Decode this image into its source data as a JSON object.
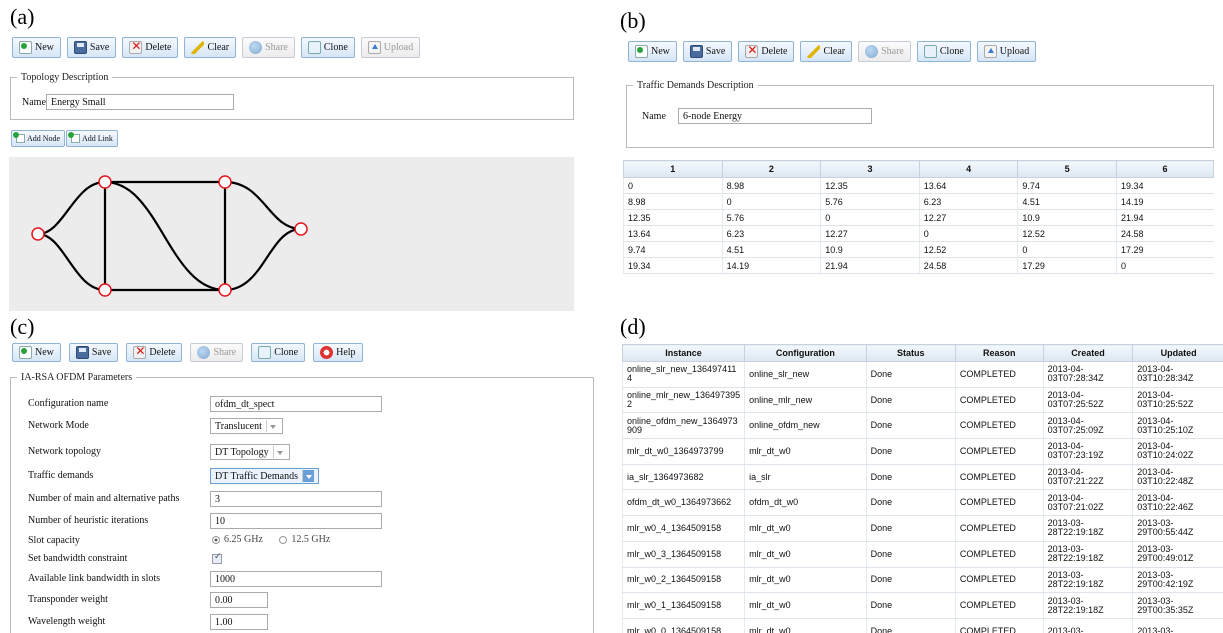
{
  "panels": {
    "a": "(a)",
    "b": "(b)",
    "c": "(c)",
    "d": "(d)"
  },
  "panel_a": {
    "toolbar": {
      "new": "New",
      "save": "Save",
      "delete": "Delete",
      "clear": "Clear",
      "share": "Share",
      "clone": "Clone",
      "upload": "Upload"
    },
    "legend": "Topology Description",
    "name_label": "Name",
    "name_value": "Energy Small",
    "add_node": "Add Node",
    "add_link": "Add Link"
  },
  "panel_b": {
    "toolbar": {
      "new": "New",
      "save": "Save",
      "delete": "Delete",
      "clear": "Clear",
      "share": "Share",
      "clone": "Clone",
      "upload": "Upload"
    },
    "legend": "Traffic Demands Description",
    "name_label": "Name",
    "name_value": "6-node Energy",
    "matrix": {
      "headers": [
        "1",
        "2",
        "3",
        "4",
        "5",
        "6"
      ],
      "rows": [
        [
          "0",
          "8.98",
          "12.35",
          "13.64",
          "9.74",
          "19.34"
        ],
        [
          "8.98",
          "0",
          "5.76",
          "6.23",
          "4.51",
          "14.19"
        ],
        [
          "12.35",
          "5.76",
          "0",
          "12.27",
          "10.9",
          "21.94"
        ],
        [
          "13.64",
          "6.23",
          "12.27",
          "0",
          "12.52",
          "24.58"
        ],
        [
          "9.74",
          "4.51",
          "10.9",
          "12.52",
          "0",
          "17.29"
        ],
        [
          "19.34",
          "14.19",
          "21.94",
          "24.58",
          "17.29",
          "0"
        ]
      ]
    }
  },
  "panel_c": {
    "toolbar": {
      "new": "New",
      "save": "Save",
      "delete": "Delete",
      "share": "Share",
      "clone": "Clone",
      "help": "Help"
    },
    "legend": "IA-RSA OFDM Parameters",
    "fields": {
      "config_name_label": "Configuration name",
      "config_name_value": "ofdm_dt_spect",
      "network_mode_label": "Network Mode",
      "network_mode_value": "Translucent",
      "topology_label": "Network topology",
      "topology_value": "DT Topology",
      "traffic_label": "Traffic demands",
      "traffic_value": "DT Traffic Demands",
      "paths_label": "Number of main and alternative paths",
      "paths_value": "3",
      "heuristic_label": "Number of heuristic iterations",
      "heuristic_value": "10",
      "slot_label": "Slot capacity",
      "slot_opt1": "6.25 GHz",
      "slot_opt2": "12.5 GHz",
      "bandwidth_label": "Set bandwidth constraint",
      "link_bw_label": "Available link bandwidth in slots",
      "link_bw_value": "1000",
      "transponder_label": "Transponder weight",
      "transponder_value": "0.00",
      "wavelength_label": "Wavelength weight",
      "wavelength_value": "1.00"
    }
  },
  "panel_d": {
    "headers": [
      "Instance",
      "Configuration",
      "Status",
      "Reason",
      "Created",
      "Updated"
    ],
    "rows": [
      [
        "online_slr_new_136497411 4",
        "online_slr_new",
        "Done",
        "COMPLETED",
        "2013-04- 03T07:28:34Z",
        "2013-04- 03T10:28:34Z"
      ],
      [
        "online_mlr_new_136497395 2",
        "online_mlr_new",
        "Done",
        "COMPLETED",
        "2013-04- 03T07:25:52Z",
        "2013-04- 03T10:25:52Z"
      ],
      [
        "online_ofdm_new_1364973 909",
        "online_ofdm_new",
        "Done",
        "COMPLETED",
        "2013-04- 03T07:25:09Z",
        "2013-04- 03T10:25:10Z"
      ],
      [
        "mlr_dt_w0_1364973799",
        "mlr_dt_w0",
        "Done",
        "COMPLETED",
        "2013-04- 03T07:23:19Z",
        "2013-04- 03T10:24:02Z"
      ],
      [
        "ia_slr_1364973682",
        "ia_slr",
        "Done",
        "COMPLETED",
        "2013-04- 03T07:21:22Z",
        "2013-04- 03T10:22:48Z"
      ],
      [
        "ofdm_dt_w0_1364973662",
        "ofdm_dt_w0",
        "Done",
        "COMPLETED",
        "2013-04- 03T07:21:02Z",
        "2013-04- 03T10:22:46Z"
      ],
      [
        "mlr_w0_4_1364509158",
        "mlr_dt_w0",
        "Done",
        "COMPLETED",
        "2013-03- 28T22:19:18Z",
        "2013-03- 29T00:55:44Z"
      ],
      [
        "mlr_w0_3_1364509158",
        "mlr_dt_w0",
        "Done",
        "COMPLETED",
        "2013-03- 28T22:19:18Z",
        "2013-03- 29T00:49:01Z"
      ],
      [
        "mlr_w0_2_1364509158",
        "mlr_dt_w0",
        "Done",
        "COMPLETED",
        "2013-03- 28T22:19:18Z",
        "2013-03- 29T00:42:19Z"
      ],
      [
        "mlr_w0_1_1364509158",
        "mlr_dt_w0",
        "Done",
        "COMPLETED",
        "2013-03- 28T22:19:18Z",
        "2013-03- 29T00:35:35Z"
      ],
      [
        "mlr_w0_0_1364509158",
        "mlr_dt_w0",
        "Done",
        "COMPLETED",
        "2013-03-",
        "2013-03-"
      ]
    ]
  },
  "colors": {
    "node_stroke": "#e8141c",
    "link": "#000000",
    "canvas_bg": "#ececec"
  }
}
